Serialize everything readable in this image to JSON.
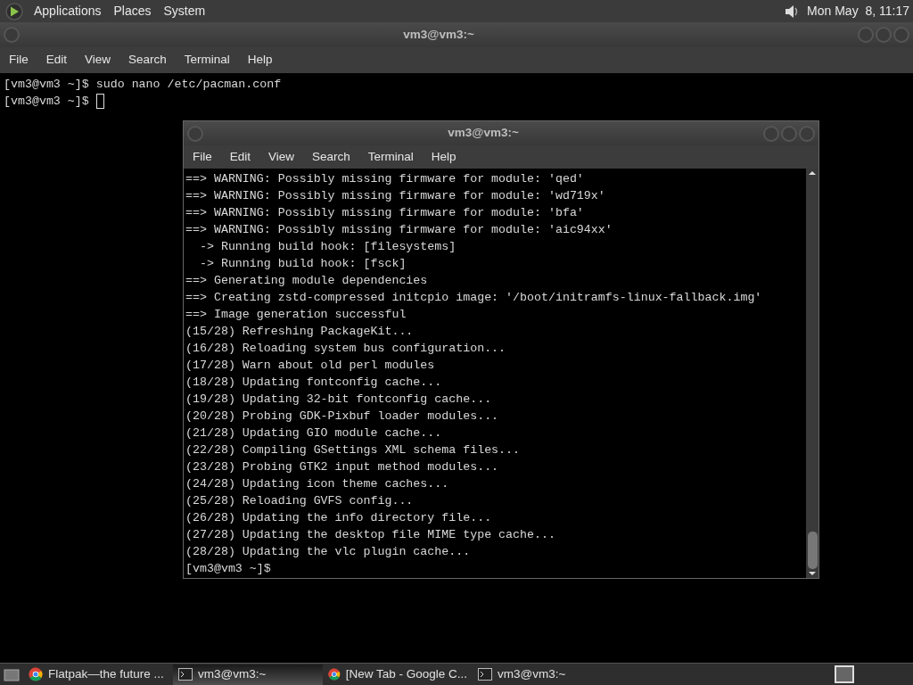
{
  "top_panel": {
    "menus": [
      "Applications",
      "Places",
      "System"
    ],
    "clock": "Mon May  8, 11:17"
  },
  "back_window": {
    "title": "vm3@vm3:~",
    "menu": [
      "File",
      "Edit",
      "View",
      "Search",
      "Terminal",
      "Help"
    ],
    "lines": [
      "[vm3@vm3 ~]$ sudo nano /etc/pacman.conf",
      "[vm3@vm3 ~]$ "
    ]
  },
  "front_window": {
    "title": "vm3@vm3:~",
    "menu": [
      "File",
      "Edit",
      "View",
      "Search",
      "Terminal",
      "Help"
    ],
    "lines": [
      "==> WARNING: Possibly missing firmware for module: 'qed'",
      "==> WARNING: Possibly missing firmware for module: 'wd719x'",
      "==> WARNING: Possibly missing firmware for module: 'bfa'",
      "==> WARNING: Possibly missing firmware for module: 'aic94xx'",
      "  -> Running build hook: [filesystems]",
      "  -> Running build hook: [fsck]",
      "==> Generating module dependencies",
      "==> Creating zstd-compressed initcpio image: '/boot/initramfs-linux-fallback.img'",
      "==> Image generation successful",
      "(15/28) Refreshing PackageKit...",
      "(16/28) Reloading system bus configuration...",
      "(17/28) Warn about old perl modules",
      "(18/28) Updating fontconfig cache...",
      "(19/28) Updating 32-bit fontconfig cache...",
      "(20/28) Probing GDK-Pixbuf loader modules...",
      "(21/28) Updating GIO module cache...",
      "(22/28) Compiling GSettings XML schema files...",
      "(23/28) Probing GTK2 input method modules...",
      "(24/28) Updating icon theme caches...",
      "(25/28) Reloading GVFS config...",
      "(26/28) Updating the info directory file...",
      "(27/28) Updating the desktop file MIME type cache...",
      "(28/28) Updating the vlc plugin cache...",
      "[vm3@vm3 ~]$"
    ]
  },
  "taskbar": [
    {
      "kind": "browser",
      "label": "Flatpak—the future ...",
      "selected": false
    },
    {
      "kind": "terminal",
      "label": "vm3@vm3:~",
      "selected": true
    },
    {
      "kind": "browser",
      "label": "[New Tab - Google C...",
      "selected": false
    },
    {
      "kind": "terminal",
      "label": "vm3@vm3:~",
      "selected": false
    }
  ]
}
